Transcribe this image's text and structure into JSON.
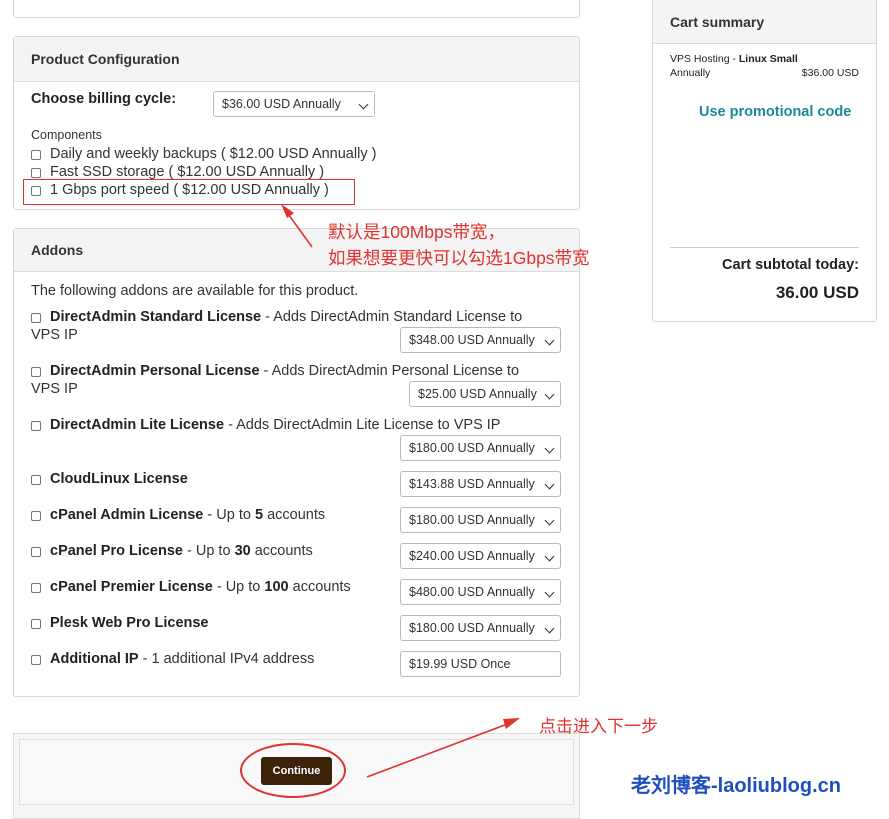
{
  "product_config": {
    "title": "Product Configuration",
    "billing_label": "Choose billing cycle:",
    "billing_value": "$36.00 USD Annually",
    "components_label": "Components",
    "components": [
      {
        "label": "Daily and weekly backups ( $12.00 USD Annually )"
      },
      {
        "label": "Fast SSD storage ( $12.00 USD Annually )"
      },
      {
        "label": "1 Gbps port speed ( $12.00 USD Annually )"
      }
    ]
  },
  "addons": {
    "title": "Addons",
    "intro": "The following addons are available for this product.",
    "items": [
      {
        "name": "DirectAdmin Standard License",
        "desc_line1": " - Adds DirectAdmin Standard License to",
        "desc_line2": "VPS IP",
        "price": "$348.00 USD Annually"
      },
      {
        "name": "DirectAdmin Personal License",
        "desc_line1": " - Adds DirectAdmin Personal License to",
        "desc_line2": "VPS IP",
        "price": "$25.00 USD Annually"
      },
      {
        "name": "DirectAdmin Lite License",
        "desc_line1": " - Adds DirectAdmin Lite License to VPS IP",
        "price": "$180.00 USD Annually"
      },
      {
        "name": "CloudLinux License",
        "price": "$143.88 USD Annually"
      },
      {
        "name": "cPanel Admin License",
        "desc_a": " - Up to ",
        "desc_num": "5",
        "desc_b": " accounts",
        "price": "$180.00 USD Annually"
      },
      {
        "name": "cPanel Pro License",
        "desc_a": " - Up to ",
        "desc_num": "30",
        "desc_b": " accounts",
        "price": "$240.00 USD Annually"
      },
      {
        "name": "cPanel Premier License",
        "desc_a": " - Up to ",
        "desc_num": "100",
        "desc_b": " accounts",
        "price": "$480.00 USD Annually"
      },
      {
        "name": "Plesk Web Pro License",
        "price": "$180.00 USD Annually"
      },
      {
        "name": "Additional IP",
        "desc_line1": " - 1 additional IPv4 address",
        "price": "$19.99 USD Once"
      }
    ]
  },
  "cart": {
    "title": "Cart summary",
    "item_prefix": "VPS Hosting - ",
    "item_name": "Linux Small",
    "item_cycle": "Annually",
    "item_price": "$36.00 USD",
    "promo_link": "Use promotional code",
    "subtotal_label": "Cart subtotal today:",
    "subtotal_value": "36.00 USD"
  },
  "continue_label": "Continue",
  "annotations": {
    "bandwidth_line1": "默认是100Mbps带宽，",
    "bandwidth_line2": "如果想要更快可以勾选1Gbps带宽",
    "next_step": "点击进入下一步",
    "watermark": "老刘博客-laoliublog.cn"
  },
  "colors": {
    "promo_link": "#1a8a9a",
    "continue_bg": "#3d220a",
    "annotation_red": "#e0322f",
    "watermark_blue": "#1f4fbf"
  }
}
